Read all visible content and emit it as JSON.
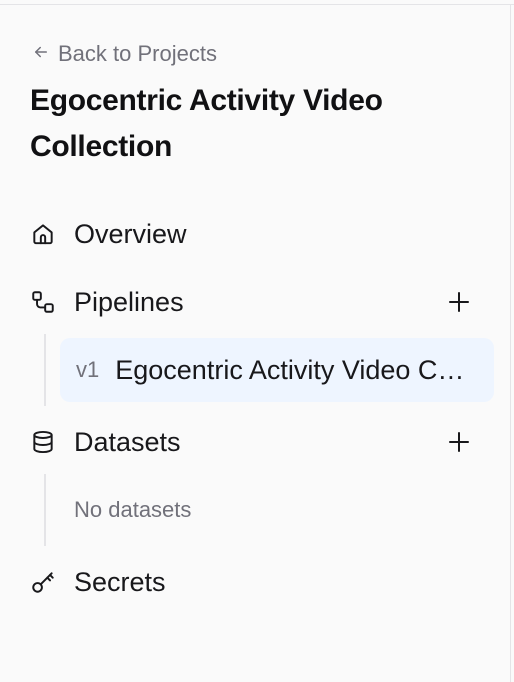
{
  "nav": {
    "back_label": "Back to Projects",
    "project_title": "Egocentric Activity Video Collection",
    "items": [
      {
        "label": "Overview",
        "icon": "home-icon"
      },
      {
        "label": "Pipelines",
        "icon": "pipeline-icon",
        "has_add": true
      },
      {
        "label": "Datasets",
        "icon": "database-icon",
        "has_add": true
      },
      {
        "label": "Secrets",
        "icon": "key-icon"
      }
    ],
    "pipelines": [
      {
        "version": "v1",
        "name": "Egocentric Activity Video Collection"
      }
    ],
    "datasets_empty": "No datasets"
  },
  "colors": {
    "background": "#fafafa",
    "selected_bg": "#eef5ff",
    "muted_text": "#71717a",
    "text": "#18181b"
  }
}
